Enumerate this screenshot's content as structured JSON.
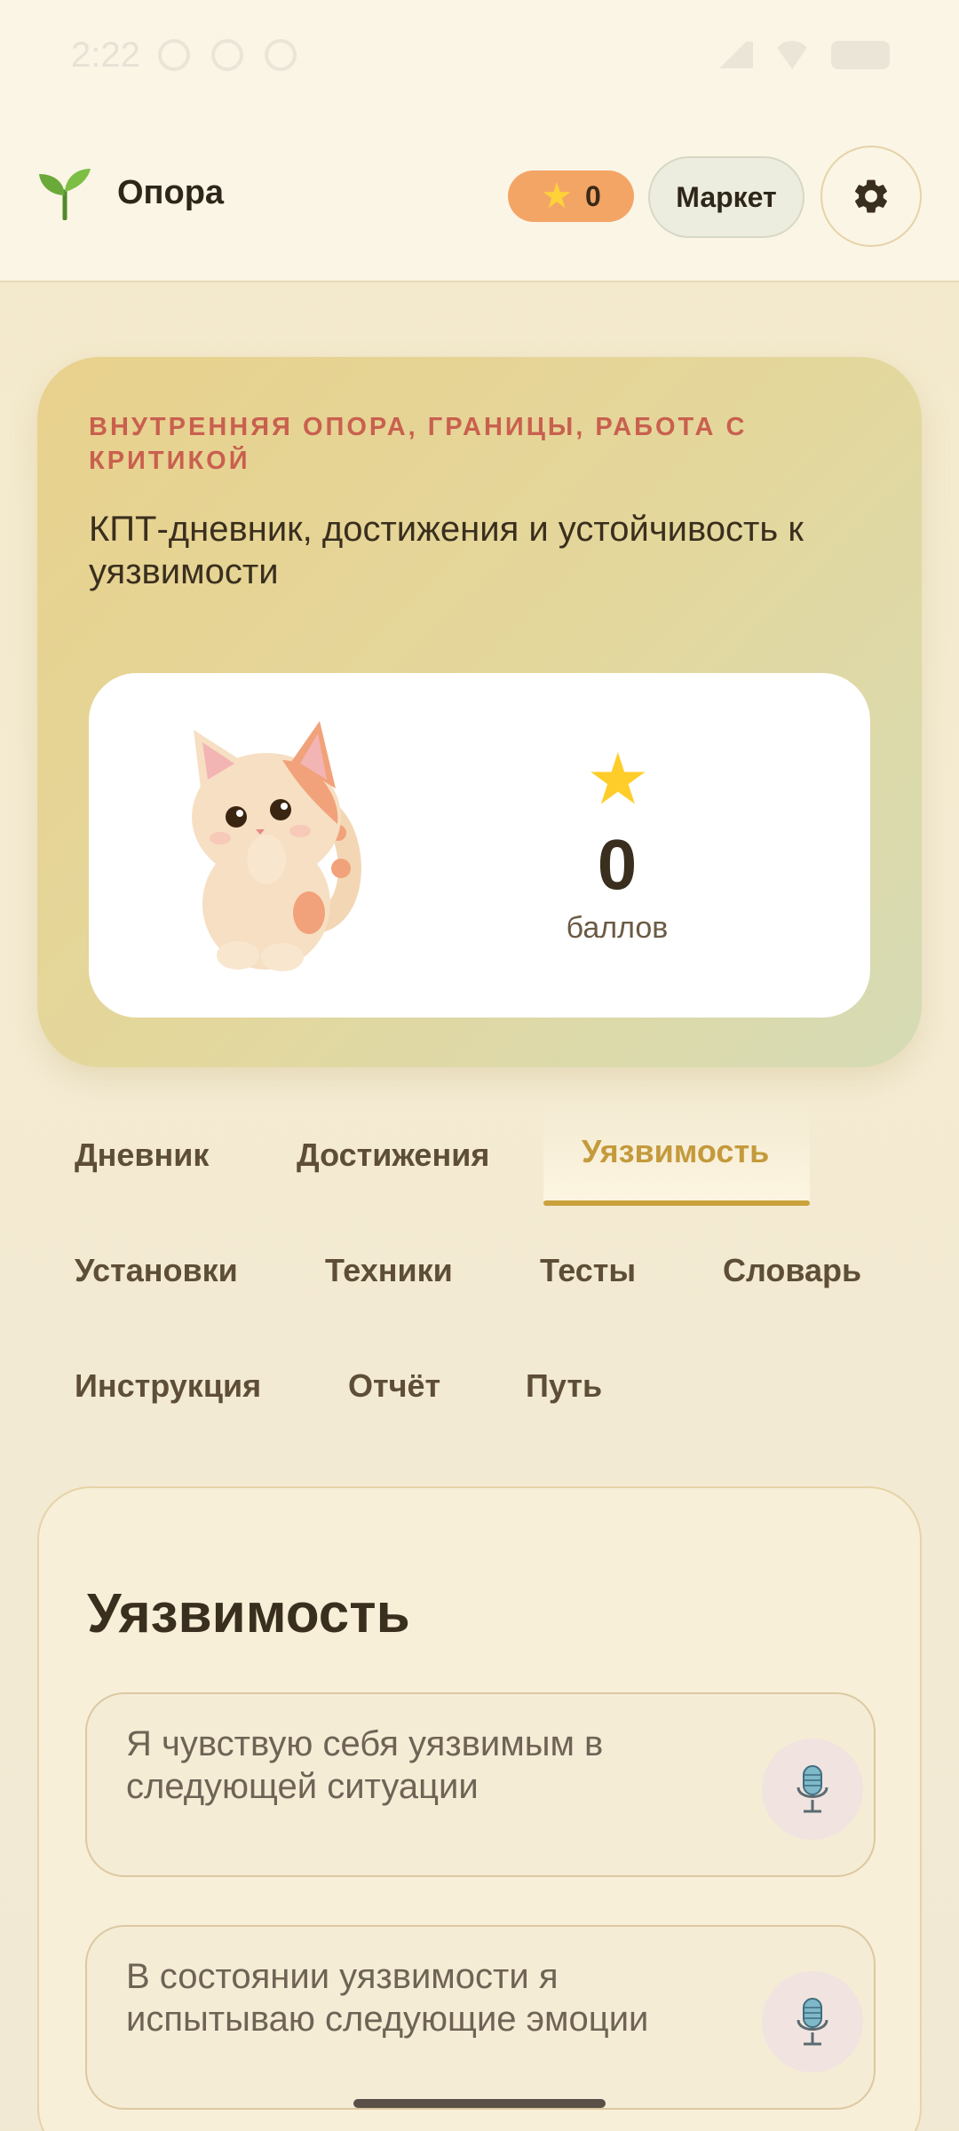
{
  "status_bar": {
    "time": "2:22"
  },
  "header": {
    "app_title": "Опора",
    "stars_count": "0",
    "market_label": "Маркет",
    "icons": [
      "sprout-icon",
      "star-icon",
      "gear-icon"
    ]
  },
  "hero": {
    "kicker": "ВНУТРЕННЯЯ ОПОРА, ГРАНИЦЫ, РАБОТА С КРИТИКОЙ",
    "subtitle": "КПТ-дневник, достижения и устойчивость к уязвимости",
    "score_value": "0",
    "score_label": "баллов"
  },
  "tabs": {
    "row1": [
      "Дневник",
      "Достижения",
      "Уязвимость"
    ],
    "row2": [
      "Установки",
      "Техники",
      "Тесты",
      "Словарь"
    ],
    "row3": [
      "Инструкция",
      "Отчёт",
      "Путь"
    ],
    "active": "Уязвимость"
  },
  "section": {
    "title": "Уязвимость",
    "fields": [
      {
        "placeholder": "Я чувствую себя уязвимым в следующей ситуации"
      },
      {
        "placeholder": "В состоянии уязвимости я испытываю следующие эмоции"
      }
    ]
  },
  "colors": {
    "accent": "#c9a23d",
    "kicker": "#c9604f",
    "stars_pill": "#f3a566",
    "background": "#f3e8c8"
  }
}
